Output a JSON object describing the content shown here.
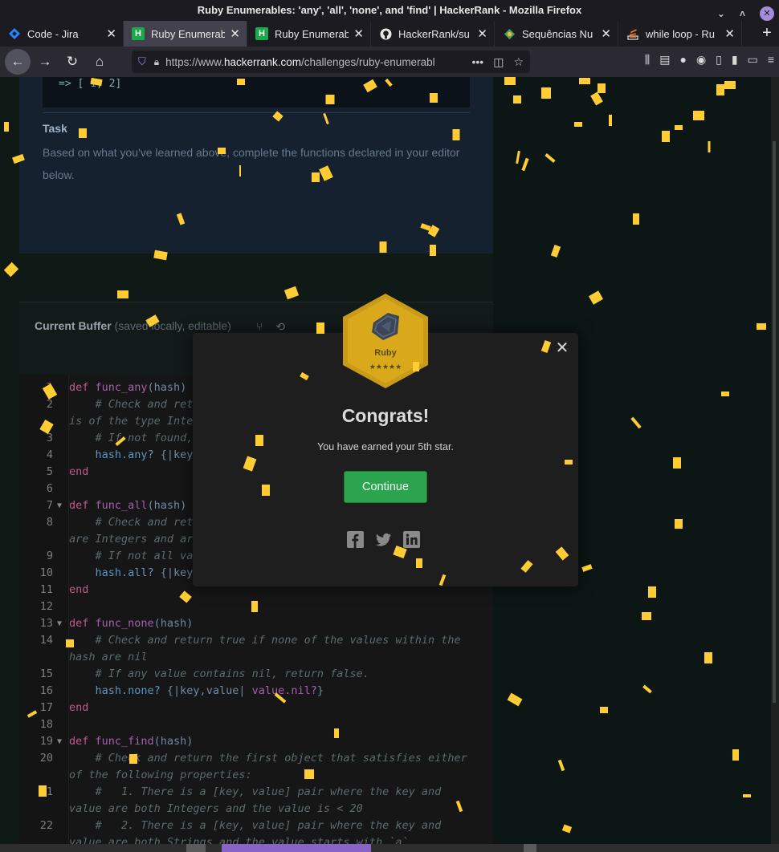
{
  "window": {
    "title": "Ruby Enumerables: 'any', 'all', 'none', and 'find' | HackerRank - Mozilla Firefox",
    "buttons": [
      "⌄",
      "˄",
      "✕"
    ]
  },
  "tabs": [
    {
      "label": "Code - Jira",
      "icon": "jira-icon",
      "active": false
    },
    {
      "label": "Ruby Enumerab",
      "icon": "hackerrank-icon",
      "active": true
    },
    {
      "label": "Ruby Enumerab",
      "icon": "hackerrank-icon",
      "active": false
    },
    {
      "label": "HackerRank/su",
      "icon": "github-icon",
      "active": false
    },
    {
      "label": "Sequências Nu",
      "icon": "globe-icon",
      "active": false
    },
    {
      "label": "while loop - Ru",
      "icon": "stackoverflow-icon",
      "active": false
    }
  ],
  "newtab_label": "+",
  "nav": {
    "url_prefix": "https://www.",
    "url_domain": "hackerrank.com",
    "url_rest": "/challenges/ruby-enumerabl",
    "more": "•••"
  },
  "page": {
    "code_snippet": "=> [",
    "code_snippet_end": ", 2]",
    "task_title": "Task",
    "task_body": "Based on what you've learned above, complete the functions declared in your editor below.",
    "buffer_title": "Current Buffer",
    "buffer_sub": "(saved locally, editable)"
  },
  "code_lines": [
    {
      "n": "1",
      "fold": "",
      "parts": [
        [
          "kw",
          "def "
        ],
        [
          "fn",
          "func_any"
        ],
        [
          "id",
          "(hash)"
        ]
      ]
    },
    {
      "n": "2",
      "fold": "",
      "parts": [
        [
          "cm",
          "    # Check and return true if any key object within the hash"
        ]
      ]
    },
    {
      "n": "",
      "fold": "",
      "parts": [
        [
          "cm",
          "is of the type Integer"
        ]
      ]
    },
    {
      "n": "3",
      "fold": "",
      "parts": [
        [
          "cm",
          "    # If not found, return false."
        ]
      ]
    },
    {
      "n": "4",
      "fold": "",
      "parts": [
        [
          "mt",
          "    hash.any? "
        ],
        [
          "id",
          "{|key, value| key.is_a? Integer}"
        ]
      ]
    },
    {
      "n": "5",
      "fold": "",
      "parts": [
        [
          "kw",
          "end"
        ]
      ]
    },
    {
      "n": "6",
      "fold": "",
      "parts": []
    },
    {
      "n": "7",
      "fold": "▼",
      "parts": [
        [
          "kw",
          "def "
        ],
        [
          "fn",
          "func_all"
        ],
        [
          "id",
          "(hash)"
        ]
      ]
    },
    {
      "n": "8",
      "fold": "",
      "parts": [
        [
          "cm",
          "    # Check and return true if all the values within the hash"
        ]
      ]
    },
    {
      "n": "",
      "fold": "",
      "parts": [
        [
          "cm",
          "are Integers and are < 10"
        ]
      ]
    },
    {
      "n": "9",
      "fold": "",
      "parts": [
        [
          "cm",
          "    # If not all values satisfy this, return false."
        ]
      ]
    },
    {
      "n": "10",
      "fold": "",
      "parts": [
        [
          "mt",
          "    hash.all? "
        ],
        [
          "id",
          "{|key, value| value.is_a?(Integer) && value < 10}"
        ]
      ]
    },
    {
      "n": "11",
      "fold": "",
      "parts": [
        [
          "kw",
          "end"
        ]
      ]
    },
    {
      "n": "12",
      "fold": "",
      "parts": []
    },
    {
      "n": "13",
      "fold": "▼",
      "parts": [
        [
          "kw",
          "def "
        ],
        [
          "fn",
          "func_none"
        ],
        [
          "id",
          "(hash)"
        ]
      ]
    },
    {
      "n": "14",
      "fold": "",
      "parts": [
        [
          "cm",
          "    # Check and return true if none of the values within the"
        ]
      ]
    },
    {
      "n": "",
      "fold": "",
      "parts": [
        [
          "cm",
          "hash are nil"
        ]
      ]
    },
    {
      "n": "15",
      "fold": "",
      "parts": [
        [
          "cm",
          "    # If any value contains nil, return false."
        ]
      ]
    },
    {
      "n": "16",
      "fold": "",
      "parts": [
        [
          "mt",
          "    hash.none? "
        ],
        [
          "id",
          "{|key,value| "
        ],
        [
          "fn",
          "value.nil?"
        ],
        [
          "id",
          "}"
        ]
      ]
    },
    {
      "n": "17",
      "fold": "",
      "parts": [
        [
          "kw",
          "end"
        ]
      ]
    },
    {
      "n": "18",
      "fold": "",
      "parts": []
    },
    {
      "n": "19",
      "fold": "▼",
      "parts": [
        [
          "kw",
          "def "
        ],
        [
          "fn",
          "func_find"
        ],
        [
          "id",
          "(hash)"
        ]
      ]
    },
    {
      "n": "20",
      "fold": "",
      "parts": [
        [
          "cm",
          "    # Check and return the first object that satisfies either"
        ]
      ]
    },
    {
      "n": "",
      "fold": "",
      "parts": [
        [
          "cm",
          "of the following properties:"
        ]
      ]
    },
    {
      "n": "21",
      "fold": "",
      "parts": [
        [
          "cm",
          "    #   1. There is a [key, value] pair where the key and"
        ]
      ]
    },
    {
      "n": "",
      "fold": "",
      "parts": [
        [
          "cm",
          "value are both Integers and the value is < 20"
        ]
      ]
    },
    {
      "n": "22",
      "fold": "",
      "parts": [
        [
          "cm",
          "    #   2. There is a [key, value] pair where the key and"
        ]
      ]
    },
    {
      "n": "",
      "fold": "",
      "parts": [
        [
          "cm",
          "value are both Strings and the value starts with `a`."
        ]
      ]
    }
  ],
  "modal": {
    "badge_label": "Ruby",
    "badge_stars": "★★★★★",
    "title": "Congrats!",
    "message": "You have earned your 5th star.",
    "continue_label": "Continue",
    "close_label": "✕"
  },
  "colors": {
    "accent_green": "#2ca44f",
    "badge_gold": "#c99a18",
    "confetti": "#ffcc33"
  }
}
